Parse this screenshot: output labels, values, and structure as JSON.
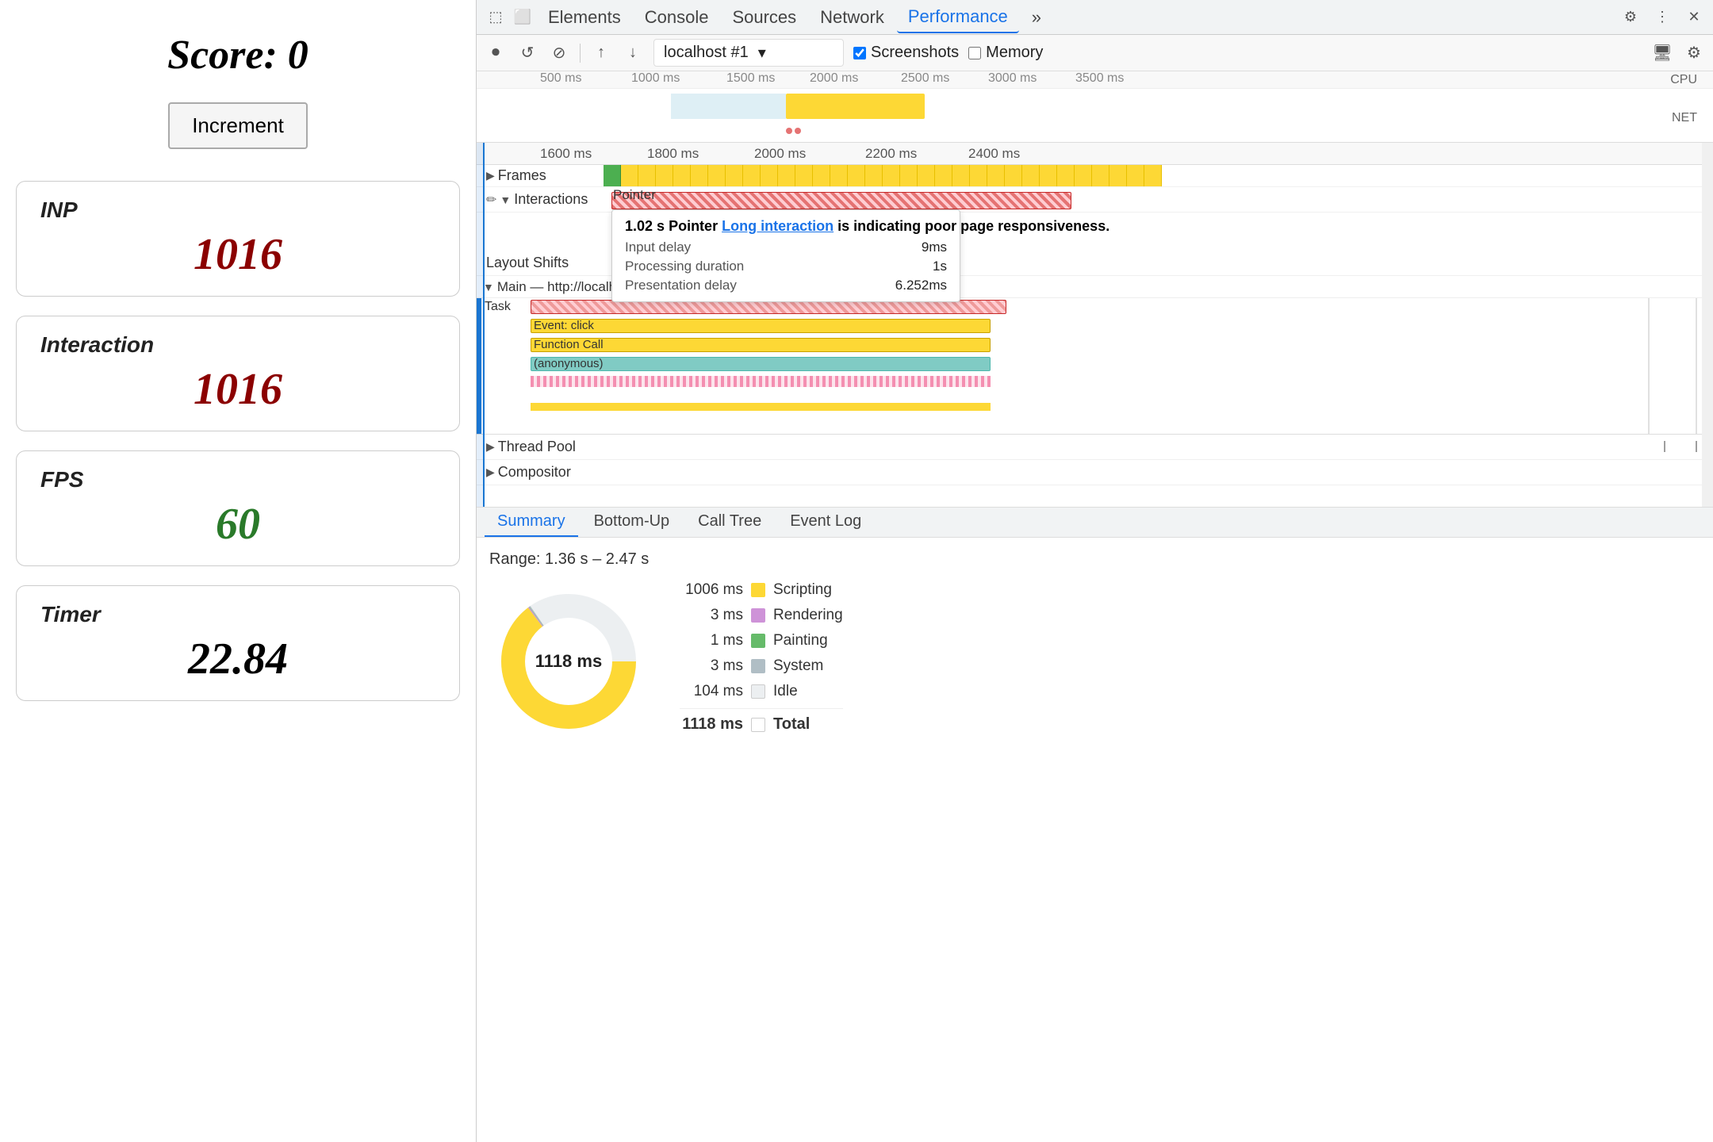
{
  "left": {
    "score_label": "Score: 0",
    "increment_btn": "Increment",
    "metrics": [
      {
        "label": "INP",
        "value": "1016",
        "color": "red"
      },
      {
        "label": "Interaction",
        "value": "1016",
        "color": "red"
      },
      {
        "label": "FPS",
        "value": "60",
        "color": "green"
      },
      {
        "label": "Timer",
        "value": "22.84",
        "color": "black"
      }
    ]
  },
  "devtools": {
    "tabs": [
      "Elements",
      "Console",
      "Sources",
      "Network",
      "Performance",
      "»"
    ],
    "active_tab": "Performance",
    "toolbar": {
      "url": "localhost #1",
      "screenshots_label": "Screenshots",
      "memory_label": "Memory"
    },
    "timeline": {
      "ruler_marks": [
        "500 ms",
        "1000 ms",
        "1500 ms",
        "2000 ms",
        "2500 ms",
        "3000 ms",
        "3500 m"
      ],
      "ruler_labels": [
        "CPU",
        "NET"
      ]
    },
    "detail": {
      "ruler_marks": [
        "1600 ms",
        "1800 ms",
        "2000 ms",
        "2200 ms",
        "2400 ms"
      ],
      "tracks": {
        "frames_label": "Frames",
        "interactions_label": "Interactions",
        "pointer_label": "Pointer",
        "layout_shifts_label": "Layout Shifts",
        "main_label": "Main — http://localhost:51",
        "task_label": "Task",
        "event_click_label": "Event: click",
        "function_call_label": "Function Call",
        "anonymous_label": "(anonymous)",
        "thread_pool_label": "Thread Pool",
        "compositor_label": "Compositor"
      }
    },
    "tooltip": {
      "duration": "1.02 s",
      "interaction_type": "Pointer",
      "link_text": "Long interaction",
      "suffix": "is indicating poor page responsiveness.",
      "input_delay_label": "Input delay",
      "input_delay_val": "9ms",
      "processing_label": "Processing duration",
      "processing_val": "1s",
      "presentation_label": "Presentation delay",
      "presentation_val": "6.252ms"
    },
    "bottom_tabs": [
      "Summary",
      "Bottom-Up",
      "Call Tree",
      "Event Log"
    ],
    "active_bottom_tab": "Summary",
    "summary": {
      "range": "Range: 1.36 s – 2.47 s",
      "donut_center": "1118 ms",
      "total_label": "Total",
      "total_val": "1118 ms",
      "legend": [
        {
          "ms": "1006 ms",
          "color": "#fdd835",
          "label": "Scripting"
        },
        {
          "ms": "3 ms",
          "color": "#ce93d8",
          "label": "Rendering"
        },
        {
          "ms": "1 ms",
          "color": "#66bb6a",
          "label": "Painting"
        },
        {
          "ms": "3 ms",
          "color": "#b0bec5",
          "label": "System"
        },
        {
          "ms": "104 ms",
          "color": "#eceff1",
          "label": "Idle"
        },
        {
          "ms": "1118 ms",
          "color": "#fff",
          "label": "Total",
          "bold": true
        }
      ]
    }
  }
}
